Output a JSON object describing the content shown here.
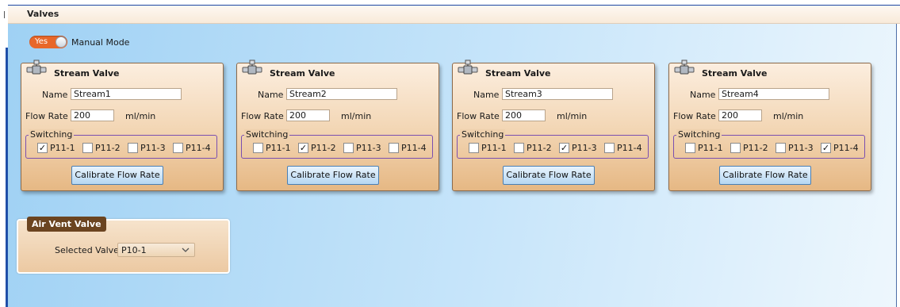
{
  "window": {
    "title": "Valves"
  },
  "manual_mode": {
    "toggle_label": "Yes",
    "label": "Manual Mode",
    "enabled": true
  },
  "stream_valves": [
    {
      "title": "Stream Valve",
      "name_label": "Name",
      "name_value": "Stream1",
      "flow_label": "Flow Rate",
      "flow_value": "200",
      "flow_unit": "ml/min",
      "switching_label": "Switching",
      "options": [
        {
          "label": "P11-1",
          "checked": true
        },
        {
          "label": "P11-2",
          "checked": false
        },
        {
          "label": "P11-3",
          "checked": false
        },
        {
          "label": "P11-4",
          "checked": false
        }
      ],
      "button": "Calibrate Flow Rate"
    },
    {
      "title": "Stream Valve",
      "name_label": "Name",
      "name_value": "Stream2",
      "flow_label": "Flow Rate",
      "flow_value": "200",
      "flow_unit": "ml/min",
      "switching_label": "Switching",
      "options": [
        {
          "label": "P11-1",
          "checked": false
        },
        {
          "label": "P11-2",
          "checked": true
        },
        {
          "label": "P11-3",
          "checked": false
        },
        {
          "label": "P11-4",
          "checked": false
        }
      ],
      "button": "Calibrate Flow Rate"
    },
    {
      "title": "Stream Valve",
      "name_label": "Name",
      "name_value": "Stream3",
      "flow_label": "Flow Rate",
      "flow_value": "200",
      "flow_unit": "ml/min",
      "switching_label": "Switching",
      "options": [
        {
          "label": "P11-1",
          "checked": false
        },
        {
          "label": "P11-2",
          "checked": false
        },
        {
          "label": "P11-3",
          "checked": true
        },
        {
          "label": "P11-4",
          "checked": false
        }
      ],
      "button": "Calibrate Flow Rate"
    },
    {
      "title": "Stream Valve",
      "name_label": "Name",
      "name_value": "Stream4",
      "flow_label": "Flow Rate",
      "flow_value": "200",
      "flow_unit": "ml/min",
      "switching_label": "Switching",
      "options": [
        {
          "label": "P11-1",
          "checked": false
        },
        {
          "label": "P11-2",
          "checked": false
        },
        {
          "label": "P11-3",
          "checked": false
        },
        {
          "label": "P11-4",
          "checked": true
        }
      ],
      "button": "Calibrate Flow Rate"
    }
  ],
  "air_vent": {
    "title": "Air Vent Valve",
    "selected_label": "Selected Valve",
    "selected_value": "P10-1"
  },
  "colors": {
    "accent_orange": "#e8672a",
    "panel_brown": "#6b4420",
    "switch_border": "#7a4fb0",
    "button_blue": "#b6d7f2"
  }
}
